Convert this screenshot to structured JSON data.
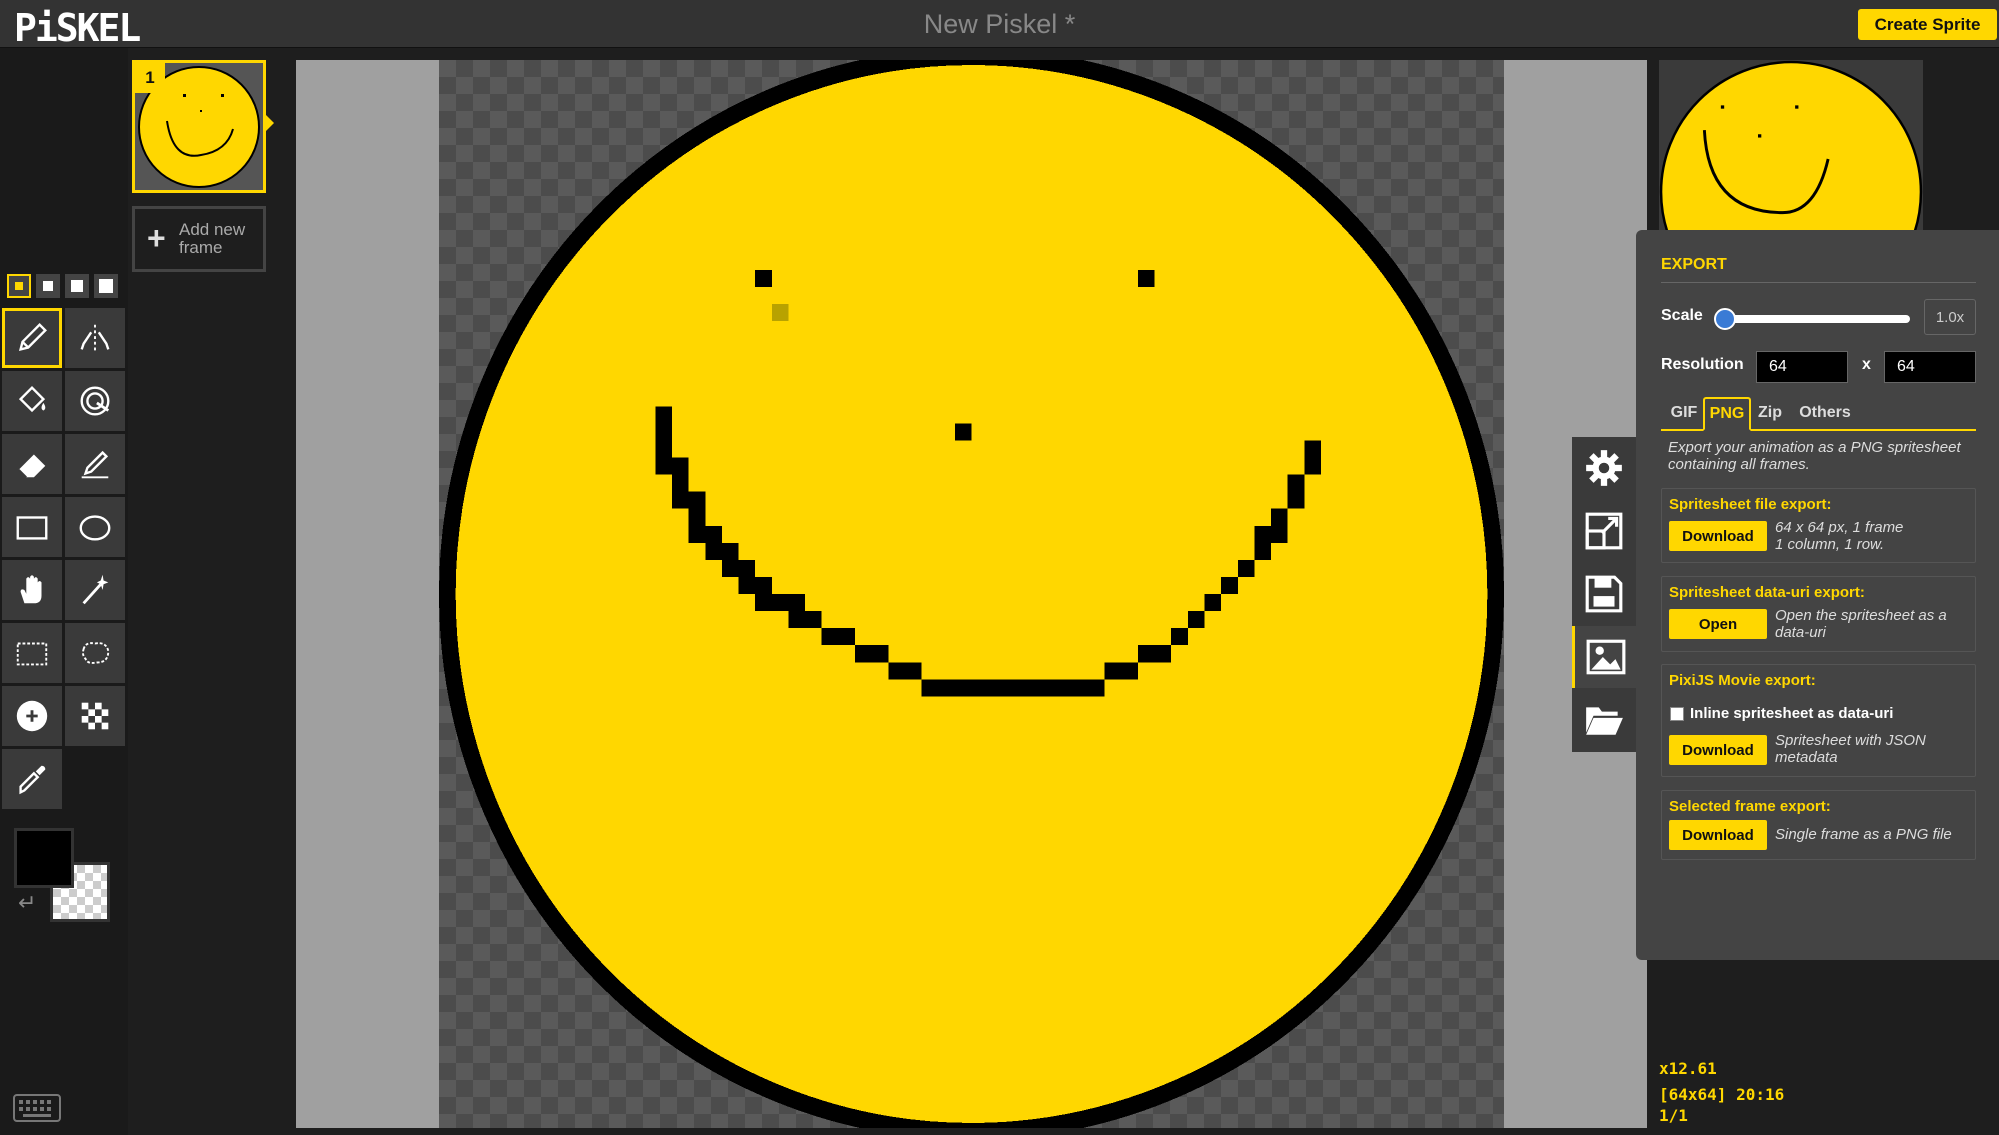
{
  "app": {
    "logo": "PiSKEL",
    "title": "New Piskel *",
    "create_label": "Create Sprite"
  },
  "frames": {
    "items": [
      {
        "number": "1"
      }
    ],
    "add_label": "Add new frame"
  },
  "pen_sizes": [
    1,
    2,
    3,
    4
  ],
  "tools": [
    "pen-tool",
    "vertical-mirror-pen-tool",
    "paint-bucket-tool",
    "paint-same-pixels-tool",
    "eraser-tool",
    "stroke-tool",
    "rectangle-tool",
    "circle-tool",
    "move-tool",
    "shape-selection-tool",
    "rectangle-selection-tool",
    "lasso-selection-tool",
    "lighten-tool",
    "dithering-tool",
    "color-picker-tool"
  ],
  "colors": {
    "primary": "#000000",
    "secondary": "transparent",
    "accent": "#ffd700",
    "sprite_fill": "#ffd700"
  },
  "export": {
    "title": "EXPORT",
    "scale_label": "Scale",
    "scale_value": "1.0x",
    "scale_fraction": 0.0,
    "resolution_label": "Resolution",
    "res_width": "64",
    "res_sep": "x",
    "res_height": "64",
    "tabs": [
      "GIF",
      "PNG",
      "Zip",
      "Others"
    ],
    "active_tab": "PNG",
    "description": "Export your animation as a PNG spritesheet containing all frames.",
    "sections": {
      "spritesheet_file": {
        "title": "Spritesheet file export:",
        "button": "Download",
        "info": "64 x 64 px, 1 frame\n1 column, 1 row."
      },
      "data_uri": {
        "title": "Spritesheet data-uri export:",
        "button": "Open",
        "info": "Open the spritesheet as a data-uri"
      },
      "pixijs": {
        "title": "PixiJS Movie export:",
        "checkbox_label": "Inline spritesheet as data-uri",
        "checked": false,
        "button": "Download",
        "info": "Spritesheet with JSON metadata"
      },
      "selected_frame": {
        "title": "Selected frame export:",
        "button": "Download",
        "info": "Single frame as a PNG file"
      }
    }
  },
  "side_menu": [
    "settings-icon",
    "resize-icon",
    "save-icon",
    "export-image-icon",
    "open-folder-icon"
  ],
  "status": {
    "zoom": "x12.61",
    "cursor": "[64x64] 20:16",
    "frame": "1/1"
  }
}
